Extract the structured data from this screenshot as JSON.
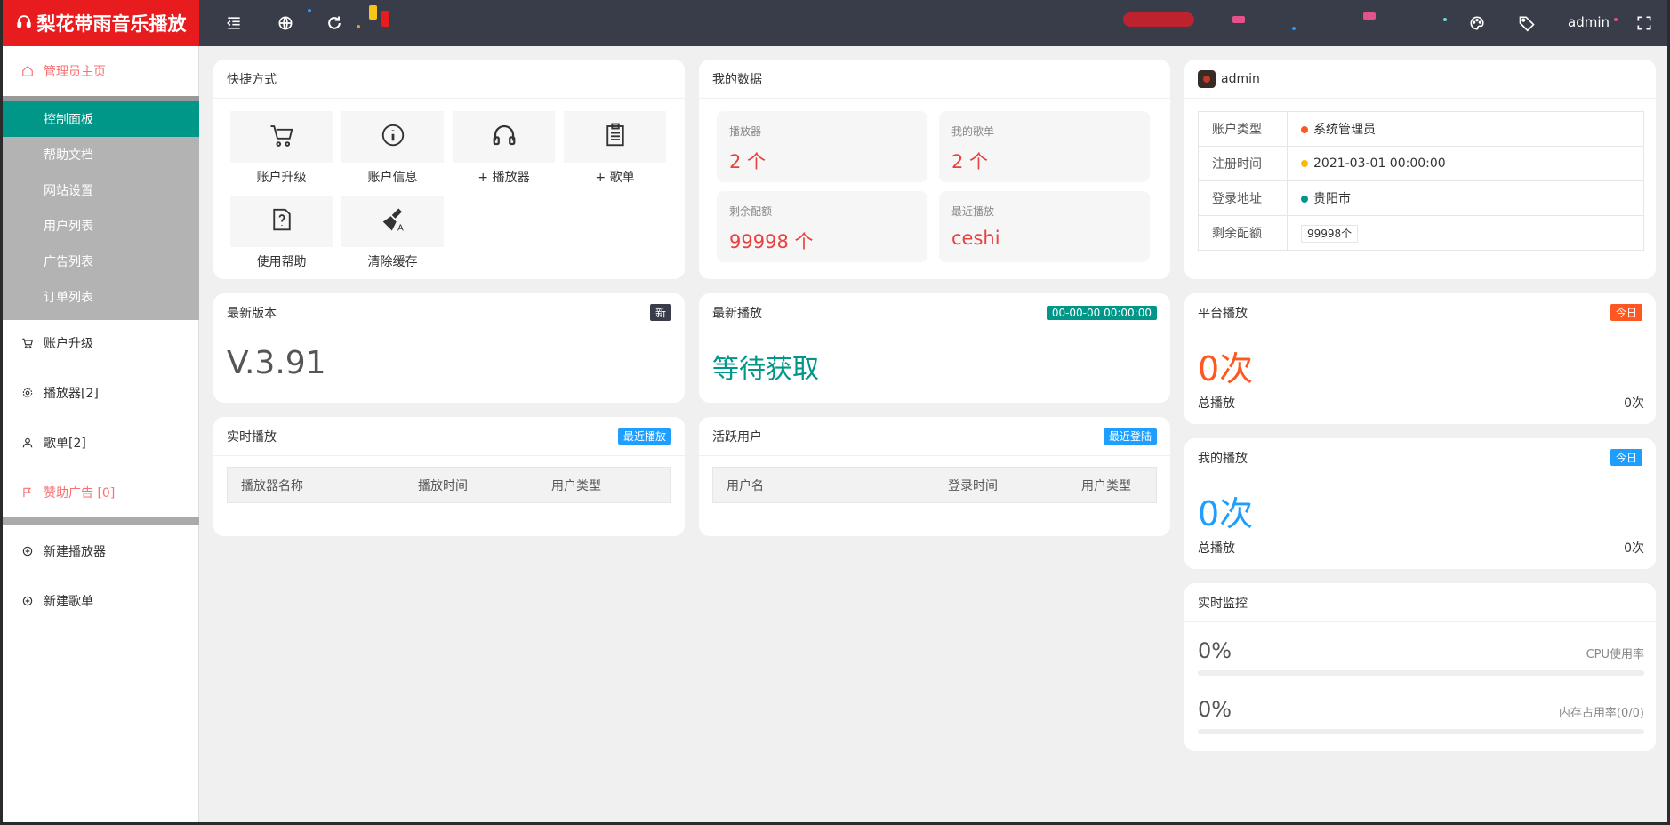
{
  "app": {
    "title": "梨花带雨音乐播放",
    "user": "admin"
  },
  "sidebar": {
    "home": "管理员主页",
    "sub": [
      "控制面板",
      "帮助文档",
      "网站设置",
      "用户列表",
      "广告列表",
      "订单列表"
    ],
    "items": [
      "账户升级",
      "播放器[2]",
      "歌单[2]",
      "赞助广告 [0]"
    ],
    "new_items": [
      "新建播放器",
      "新建歌单"
    ]
  },
  "quick": {
    "title": "快捷方式",
    "items": [
      "账户升级",
      "账户信息",
      "+ 播放器",
      "+ 歌单",
      "使用帮助",
      "清除缓存"
    ]
  },
  "mydata": {
    "title": "我的数据",
    "cells": [
      {
        "k": "播放器",
        "v": "2 个"
      },
      {
        "k": "我的歌单",
        "v": "2 个"
      },
      {
        "k": "剩余配额",
        "v": "99998 个"
      },
      {
        "k": "最近播放",
        "v": "ceshi"
      }
    ]
  },
  "account": {
    "name": "admin",
    "rows": [
      {
        "k": "账户类型",
        "v": "系统管理员",
        "color": "#ff5722"
      },
      {
        "k": "注册时间",
        "v": "2021-03-01 00:00:00",
        "color": "#ffb800"
      },
      {
        "k": "登录地址",
        "v": "贵阳市",
        "color": "#009688"
      },
      {
        "k": "剩余配额",
        "v": "99998个"
      }
    ]
  },
  "version": {
    "title": "最新版本",
    "badge": "新",
    "value": "V.3.91"
  },
  "latest": {
    "title": "最新播放",
    "badge": "00-00-00 00:00:00",
    "value": "等待获取"
  },
  "realtime": {
    "title": "实时播放",
    "badge": "最近播放",
    "cols": [
      "播放器名称",
      "播放时间",
      "用户类型"
    ]
  },
  "active": {
    "title": "活跃用户",
    "badge": "最近登陆",
    "cols": [
      "用户名",
      "登录时间",
      "用户类型"
    ]
  },
  "platform": {
    "title": "平台播放",
    "badge": "今日",
    "value": "0次",
    "total_label": "总播放",
    "total": "0次"
  },
  "myplay": {
    "title": "我的播放",
    "badge": "今日",
    "value": "0次",
    "total_label": "总播放",
    "total": "0次"
  },
  "monitor": {
    "title": "实时监控",
    "cpu_value": "0%",
    "cpu_label": "CPU使用率",
    "mem_value": "0%",
    "mem_label": "内存占用率(0/0)",
    "cpu_pct": 0,
    "mem_pct": 0
  },
  "colors": {
    "red": "#e81b1e",
    "teal": "#009688",
    "orange": "#ff5722",
    "blue": "#1e9fff",
    "dark": "#393d49"
  }
}
